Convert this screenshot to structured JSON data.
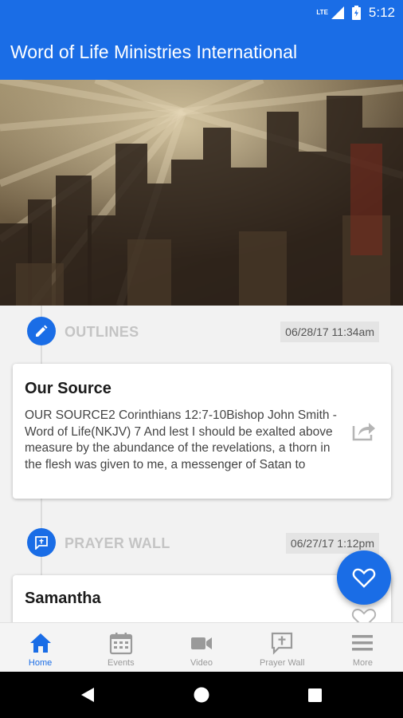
{
  "status_bar": {
    "network": "LTE",
    "time": "5:12"
  },
  "app_bar": {
    "title": "Word of Life Ministries International"
  },
  "feed": {
    "sections": [
      {
        "title": "OUTLINES",
        "timestamp": "06/28/17 11:34am",
        "icon": "pencil-icon",
        "card": {
          "title": "Our Source",
          "body": "OUR SOURCE2 Corinthians 12:7-10Bishop John Smith - Word of Life(NKJV) 7 And lest I should be exalted above measure by the abundance of the revelations, a thorn in the flesh was given to me, a messenger of Satan to buffet me, lest I be exalted…"
        }
      },
      {
        "title": "PRAYER WALL",
        "timestamp": "06/27/17 1:12pm",
        "icon": "prayer-bubble-icon",
        "card": {
          "title": "Samantha"
        }
      }
    ]
  },
  "bottom_nav": [
    {
      "label": "Home",
      "icon": "home-icon",
      "active": true
    },
    {
      "label": "Events",
      "icon": "calendar-icon",
      "active": false
    },
    {
      "label": "Video",
      "icon": "video-camera-icon",
      "active": false
    },
    {
      "label": "Prayer Wall",
      "icon": "prayer-wall-icon",
      "active": false
    },
    {
      "label": "More",
      "icon": "menu-icon",
      "active": false
    }
  ],
  "colors": {
    "primary": "#1a6de6",
    "muted": "#c4c4c4",
    "nav_inactive": "#9a9a9a"
  }
}
